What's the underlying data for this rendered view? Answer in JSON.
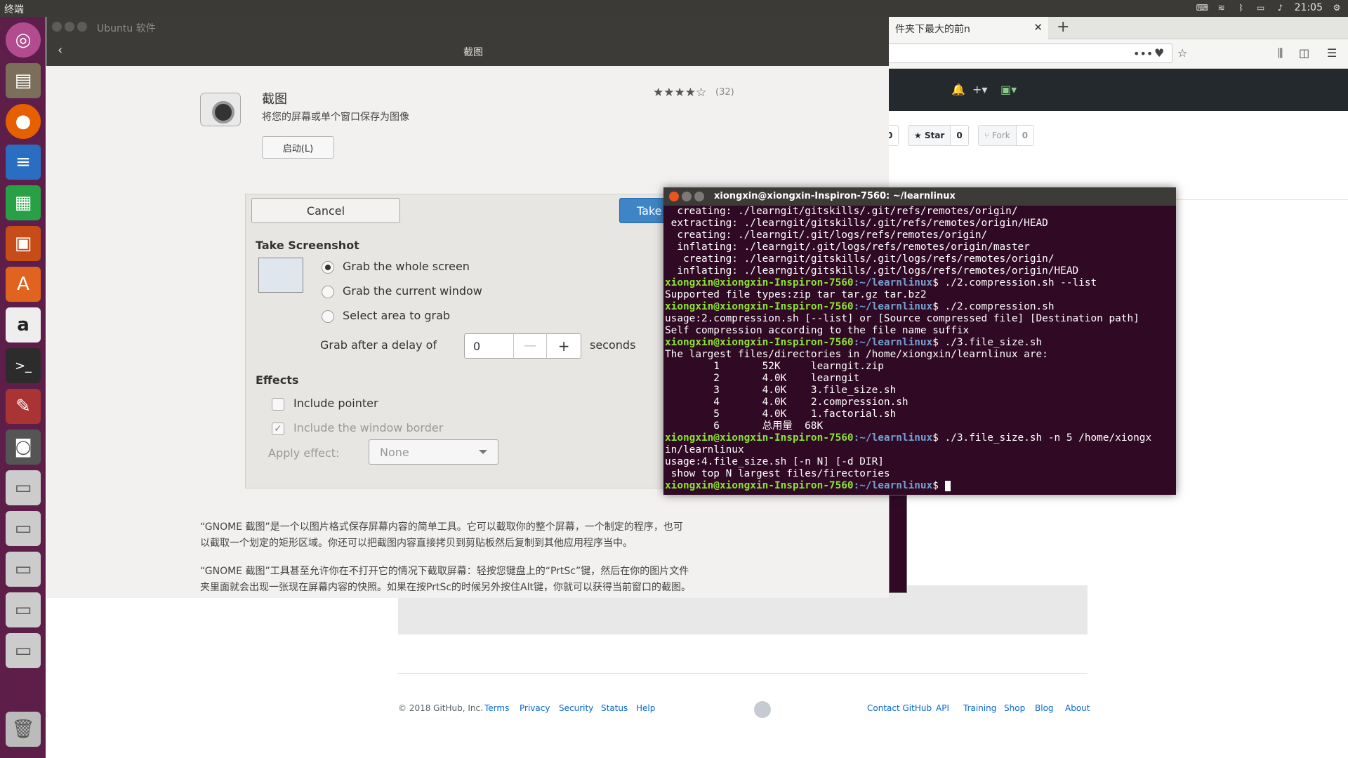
{
  "topbar": {
    "title": "终端",
    "time": "21:05"
  },
  "launcher": {
    "icons": [
      "ubuntu-dash-icon",
      "files-icon",
      "firefox-icon",
      "writer-icon",
      "calc-icon",
      "impress-icon",
      "software-center-icon",
      "amazon-icon",
      "terminal-icon",
      "settings-icon",
      "screenshot-icon",
      "drive-icon",
      "drive-icon",
      "drive-icon",
      "drive-icon",
      "drive-icon",
      "trash-icon"
    ]
  },
  "firefox": {
    "tab_title": "件夹下最大的前n",
    "github": {
      "star_label": "Star",
      "star_count": "0",
      "fork_label": "Fork",
      "fork_count": "0",
      "first_count": "0",
      "copyright": "© 2018 GitHub, Inc.",
      "footer_left": [
        "Terms",
        "Privacy",
        "Security",
        "Status",
        "Help"
      ],
      "footer_right": [
        "Contact GitHub",
        "API",
        "Training",
        "Shop",
        "Blog",
        "About"
      ]
    }
  },
  "software": {
    "window_title": "Ubuntu 软件",
    "header_title": "截图",
    "app_name": "截图",
    "app_desc": "将您的屏幕或单个窗口保存为图像",
    "launch_label": "启动(L)",
    "rating_stars": "★★★★☆",
    "reviews": "(32)",
    "para1": "“GNOME 截图”是一个以图片格式保存屏幕内容的简单工具。它可以截取你的整个屏幕，一个制定的程序，也可以截取一个划定的矩形区域。你还可以把截图内容直接拷贝到剪贴板然后复制到其他应用程序当中。",
    "para2": "“GNOME 截图”工具甚至允许你在不打开它的情况下截取屏幕：轻按您键盘上的“PrtSc”键，然后在你的图片文件夹里面就会出现一张现在屏幕内容的快照。如果在按PrtSc的时候另外按住Alt键，你就可以获得当前窗口的截图。"
  },
  "screenshot": {
    "cancel": "Cancel",
    "take": "Take Screenshot",
    "title": "Take Screenshot",
    "options": [
      "Grab the whole screen",
      "Grab the current window",
      "Select area to grab"
    ],
    "delay_label": "Grab after a delay of",
    "delay_value": "0",
    "minus": "—",
    "plus": "+",
    "seconds": "seconds",
    "effects_title": "Effects",
    "include_pointer": "Include pointer",
    "include_border": "Include the window border",
    "apply_effect": "Apply effect:",
    "effect_value": "None"
  },
  "terminal": {
    "title": "xiongxin@xiongxin-Inspiron-7560: ~/learnlinux",
    "prompt_user": "xiongxin@xiongxin-Inspiron-7560",
    "prompt_path": ":~/learnlinux",
    "lines": [
      {
        "t": "out",
        "text": "  creating: ./learngit/gitskills/.git/refs/remotes/origin/"
      },
      {
        "t": "out",
        "text": " extracting: ./learngit/gitskills/.git/refs/remotes/origin/HEAD"
      },
      {
        "t": "out",
        "text": "  creating: ./learngit/.git/logs/refs/remotes/origin/"
      },
      {
        "t": "out",
        "text": "  inflating: ./learngit/.git/logs/refs/remotes/origin/master"
      },
      {
        "t": "out",
        "text": "   creating: ./learngit/gitskills/.git/logs/refs/remotes/origin/"
      },
      {
        "t": "out",
        "text": "  inflating: ./learngit/gitskills/.git/logs/refs/remotes/origin/HEAD"
      },
      {
        "t": "cmd",
        "text": "$ ./2.compression.sh --list"
      },
      {
        "t": "out",
        "text": "Supported file types:zip tar tar.gz tar.bz2"
      },
      {
        "t": "cmd",
        "text": "$ ./2.compression.sh"
      },
      {
        "t": "out",
        "text": "usage:2.compression.sh [--list] or [Source compressed file] [Destination path]"
      },
      {
        "t": "out",
        "text": "Self compression according to the file name suffix"
      },
      {
        "t": "cmd",
        "text": "$ ./3.file_size.sh"
      },
      {
        "t": "out",
        "text": "The largest files/directories in /home/xiongxin/learnlinux are:"
      },
      {
        "t": "out",
        "text": "        1       52K     learngit.zip"
      },
      {
        "t": "out",
        "text": "        2       4.0K    learngit"
      },
      {
        "t": "out",
        "text": "        3       4.0K    3.file_size.sh"
      },
      {
        "t": "out",
        "text": "        4       4.0K    2.compression.sh"
      },
      {
        "t": "out",
        "text": "        5       4.0K    1.factorial.sh"
      },
      {
        "t": "out",
        "text": "        6       总用量  68K"
      },
      {
        "t": "cmd",
        "text": "$ ./3.file_size.sh -n 5 /home/xiongx"
      },
      {
        "t": "out",
        "text": "in/learnlinux"
      },
      {
        "t": "out",
        "text": "usage:4.file_size.sh [-n N] [-d DIR]"
      },
      {
        "t": "out",
        "text": " show top N largest files/firectories"
      },
      {
        "t": "cmd",
        "text": "$ "
      }
    ]
  }
}
